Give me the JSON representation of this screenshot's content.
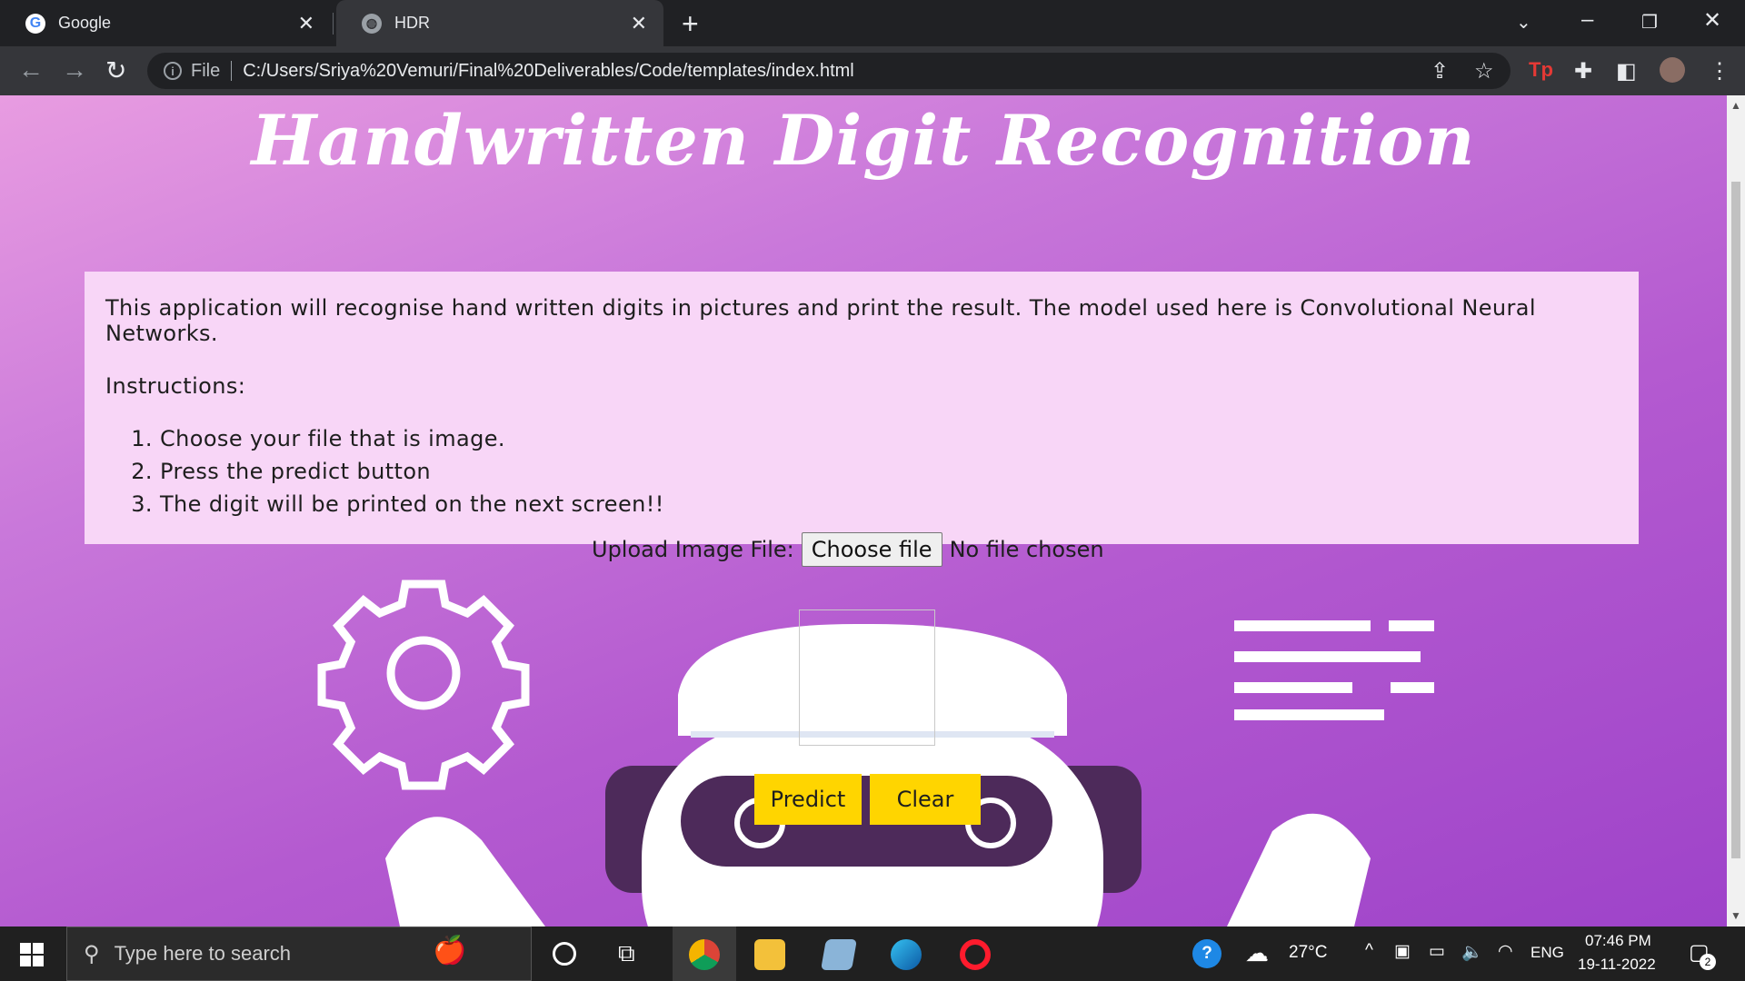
{
  "browser": {
    "tabs": [
      {
        "title": "Google",
        "favicon": "google-icon"
      },
      {
        "title": "HDR",
        "favicon": "globe-icon"
      }
    ],
    "address": {
      "scheme": "File",
      "url": "C:/Users/Sriya%20Vemuri/Final%20Deliverables/Code/templates/index.html"
    }
  },
  "page": {
    "title": "Handwritten Digit Recognition",
    "description": "This application will recognise hand written digits in pictures and print the result. The model used here is Convolutional Neural Networks.",
    "instructions_heading": "Instructions:",
    "instructions": [
      "Choose your file that is image.",
      "Press the predict button",
      "The digit will be printed on the next screen!!"
    ],
    "upload_label": "Upload Image File:",
    "choose_file": "Choose file",
    "no_file": "No file chosen",
    "predict": "Predict",
    "clear": "Clear",
    "accent_color": "#ffd500",
    "panel_color": "#f8d6f7"
  },
  "taskbar": {
    "search_placeholder": "Type here to search",
    "weather": "27°C",
    "language": "ENG",
    "time": "07:46 PM",
    "date": "19-11-2022",
    "notifications": "2"
  }
}
